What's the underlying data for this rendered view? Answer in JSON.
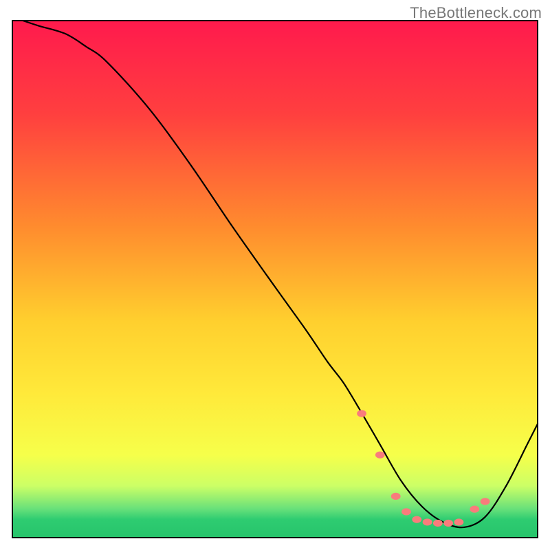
{
  "watermark": "TheBottleneck.com",
  "chart_data": {
    "type": "line",
    "title": "",
    "xlabel": "",
    "ylabel": "",
    "xlim": [
      0,
      100
    ],
    "ylim": [
      0,
      100
    ],
    "background_gradient": {
      "stops": [
        {
          "offset": 0.0,
          "color": "#ff1a4d"
        },
        {
          "offset": 0.18,
          "color": "#ff3f3f"
        },
        {
          "offset": 0.4,
          "color": "#ff8c2e"
        },
        {
          "offset": 0.58,
          "color": "#ffcf2e"
        },
        {
          "offset": 0.72,
          "color": "#ffe93a"
        },
        {
          "offset": 0.84,
          "color": "#f6ff4a"
        },
        {
          "offset": 0.9,
          "color": "#ccff66"
        },
        {
          "offset": 0.945,
          "color": "#66e07a"
        },
        {
          "offset": 0.965,
          "color": "#2ecc71"
        },
        {
          "offset": 1.0,
          "color": "#27c46b"
        }
      ]
    },
    "series": [
      {
        "name": "bottleneck-curve",
        "color": "#000000",
        "width": 2.2,
        "x": [
          2,
          5,
          10,
          14,
          18,
          26,
          34,
          42,
          50,
          56,
          60,
          63,
          66,
          70,
          74,
          78,
          82,
          86,
          90,
          94,
          98,
          100
        ],
        "y": [
          100,
          99,
          97.5,
          95,
          92,
          83,
          72,
          60,
          48.5,
          40,
          34,
          30,
          25,
          18,
          11,
          6,
          3,
          2,
          4,
          10,
          18,
          22
        ]
      }
    ],
    "markers": {
      "name": "optimal-range-points",
      "color": "#f97c7c",
      "radius": 6,
      "x": [
        66.5,
        70,
        73,
        75,
        77,
        79,
        81,
        83,
        85,
        88,
        90
      ],
      "y": [
        24,
        16,
        8,
        5,
        3.5,
        3,
        2.8,
        2.8,
        3,
        5.5,
        7
      ]
    }
  }
}
